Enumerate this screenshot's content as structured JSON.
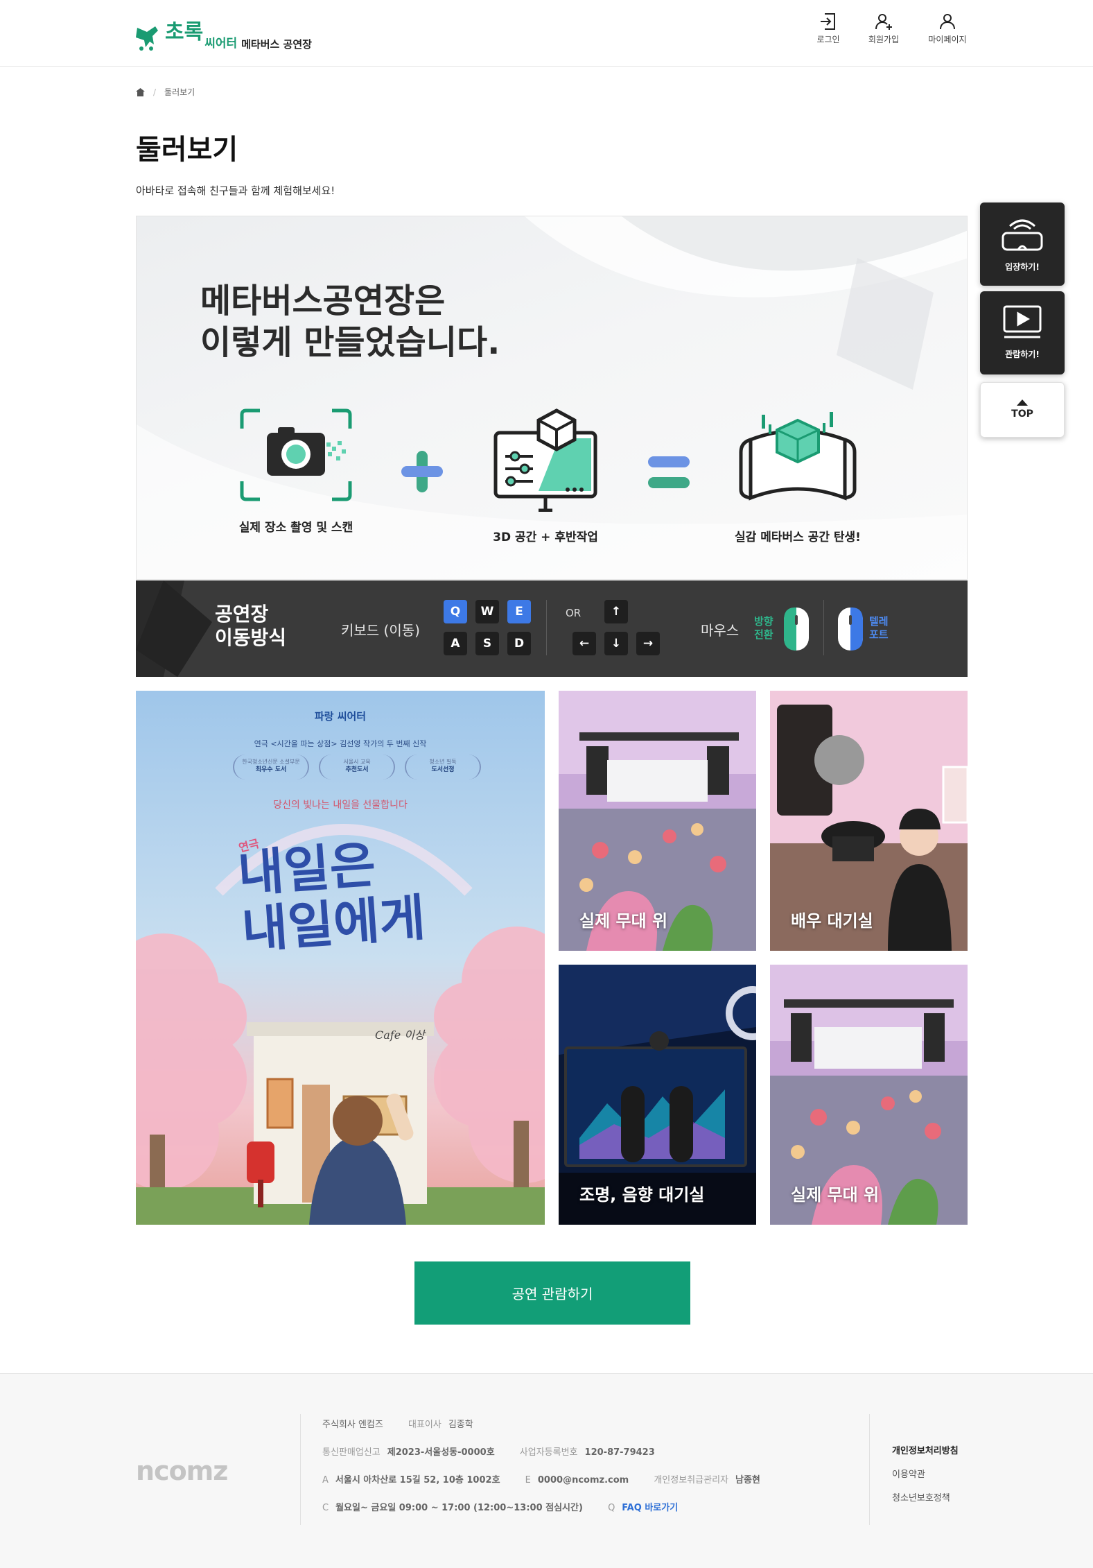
{
  "header": {
    "brand_main": "초록",
    "brand_sub": "씨어터",
    "brand_tag": "메타버스 공연장",
    "login": "로그인",
    "signup": "회원가입",
    "mypage": "마이페이지"
  },
  "breadcrumb": {
    "current": "둘러보기"
  },
  "page": {
    "title": "둘러보기",
    "description": "아바타로 접속해 친구들과 함께 체험해보세요!"
  },
  "info": {
    "heading_line1": "메타버스공연장은",
    "heading_line2": "이렇게 만들었습니다.",
    "step1": "실제 장소 촬영 및 스캔",
    "step2": "3D 공간 + 후반작업",
    "step3": "실감 메타버스 공간 탄생!"
  },
  "controls": {
    "title_line1": "공연장",
    "title_line2": "이동방식",
    "keyboard_label": "키보드 (이동)",
    "keys": [
      "Q",
      "W",
      "E",
      "A",
      "S",
      "D"
    ],
    "or_label": "OR",
    "arrows": [
      "↑",
      "←",
      "↓",
      "→"
    ],
    "mouse_label": "마우스",
    "left_line1": "방향",
    "left_line2": "전환",
    "right_line1": "텔레",
    "right_line2": "포트"
  },
  "poster": {
    "logo": "파랑 씨어터",
    "line1": "연극 <시간을 파는 상점> 김선영 작가의 두 번째 신작",
    "awards": [
      {
        "org": "한국청소년신문 소셜부문",
        "name": "최우수 도서"
      },
      {
        "org": "서울시 교육",
        "name": "추천도서"
      },
      {
        "org": "청소년 필독",
        "name": "도서선정"
      }
    ],
    "line2": "당신의 빛나는 내일을 선물합니다",
    "tag": "연극",
    "title_line1": "내일은",
    "title_line2": "내일에게",
    "cafe": "Cafe 이상"
  },
  "gallery": {
    "tile1": "실제 무대 위",
    "tile2": "배우 대기실",
    "tile3": "조명, 음향 대기실",
    "tile4": "실제 무대 위"
  },
  "cta": {
    "label": "공연 관람하기"
  },
  "floating": {
    "enter": "입장하기!",
    "watch": "관람하기!",
    "top": "TOP"
  },
  "footer": {
    "logo": "ncomz",
    "company_label": "주식회사 엔컴즈",
    "ceo_label": "대표이사",
    "ceo": "김종학",
    "mail_label": "통신판매업신고",
    "mail_no": "제2023-서울성동-0000호",
    "biz_label": "사업자등록번호",
    "biz_no": "120-87-79423",
    "addr_key": "A",
    "addr": "서울시 아차산로 15길 52, 10층 1002호",
    "email_key": "E",
    "email": "0000@ncomz.com",
    "privacy_mgr_label": "개인정보취급관리자",
    "privacy_mgr": "남종현",
    "hours_key": "C",
    "hours": "월요일~ 금요일 09:00 ~ 17:00 (12:00~13:00 점심시간)",
    "faq_key": "Q",
    "faq": "FAQ 바로가기",
    "link1": "개인정보처리방침",
    "link2": "이용약관",
    "link3": "청소년보호정책"
  },
  "colors": {
    "brand_green": "#129e77",
    "key_blue": "#3d79e6",
    "dark_bar": "#3a3a3a"
  }
}
